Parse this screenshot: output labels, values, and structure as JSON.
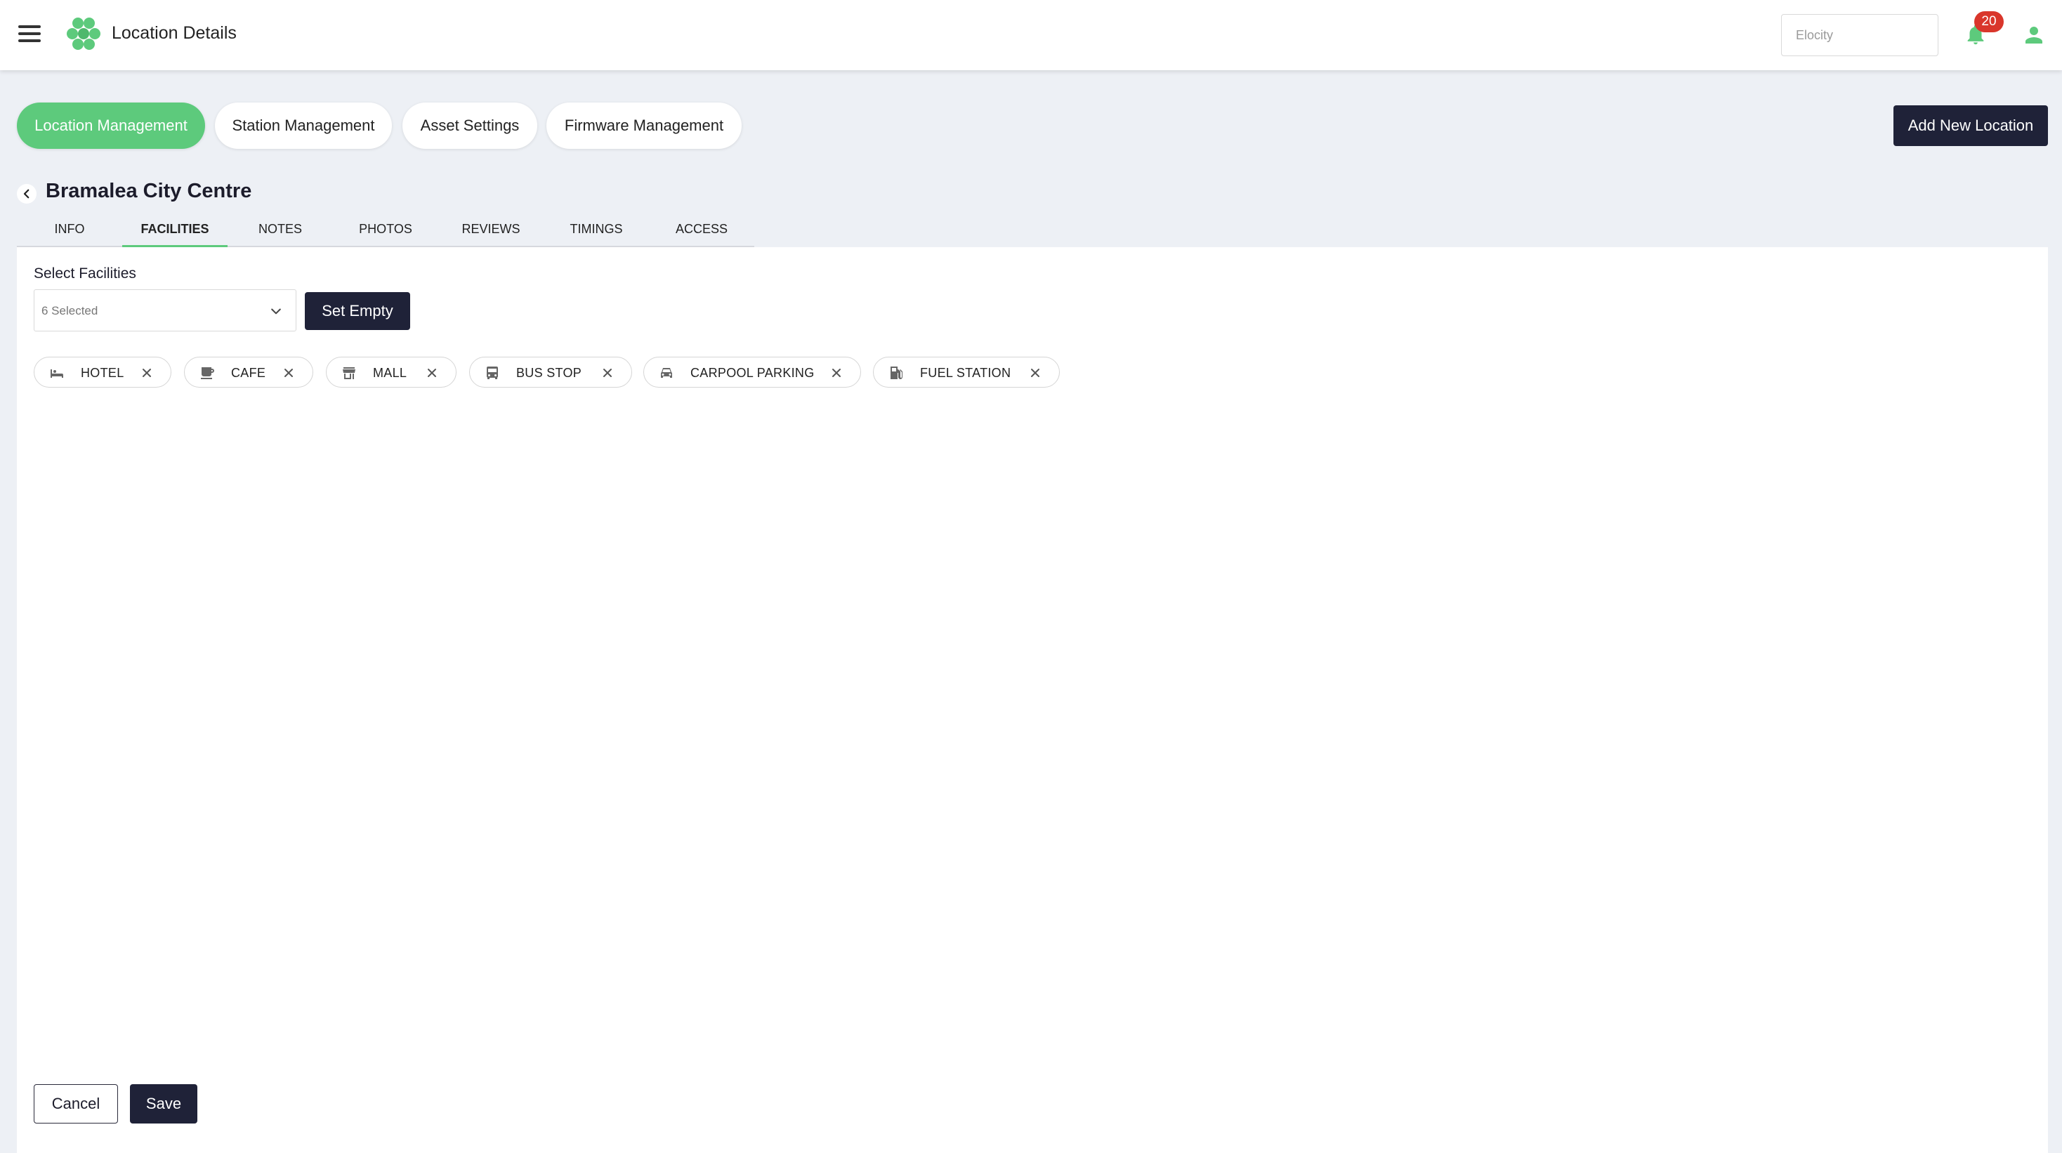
{
  "header": {
    "title": "Location Details",
    "search_placeholder": "Elocity",
    "notification_count": "20",
    "brand_color": "#5dca7c"
  },
  "nav": {
    "pills": [
      {
        "label": "Location Management",
        "active": true
      },
      {
        "label": "Station Management",
        "active": false
      },
      {
        "label": "Asset Settings",
        "active": false
      },
      {
        "label": "Firmware Management",
        "active": false
      }
    ],
    "add_button": "Add New Location"
  },
  "location": {
    "name": "Bramalea City Centre"
  },
  "tabs": [
    {
      "label": "INFO"
    },
    {
      "label": "FACILITIES",
      "active": true
    },
    {
      "label": "NOTES"
    },
    {
      "label": "PHOTOS"
    },
    {
      "label": "REVIEWS"
    },
    {
      "label": "TIMINGS"
    },
    {
      "label": "ACCESS"
    }
  ],
  "facilities": {
    "label": "Select Facilities",
    "selected_text": "6 Selected",
    "set_empty": "Set Empty",
    "chips": [
      {
        "label": "HOTEL",
        "icon": "bed-icon"
      },
      {
        "label": "CAFE",
        "icon": "coffee-icon"
      },
      {
        "label": "MALL",
        "icon": "store-icon"
      },
      {
        "label": "BUS STOP",
        "icon": "bus-icon"
      },
      {
        "label": "CARPOOL PARKING",
        "icon": "car-icon"
      },
      {
        "label": "FUEL STATION",
        "icon": "fuel-pump-icon"
      }
    ]
  },
  "actions": {
    "cancel": "Cancel",
    "save": "Save"
  }
}
